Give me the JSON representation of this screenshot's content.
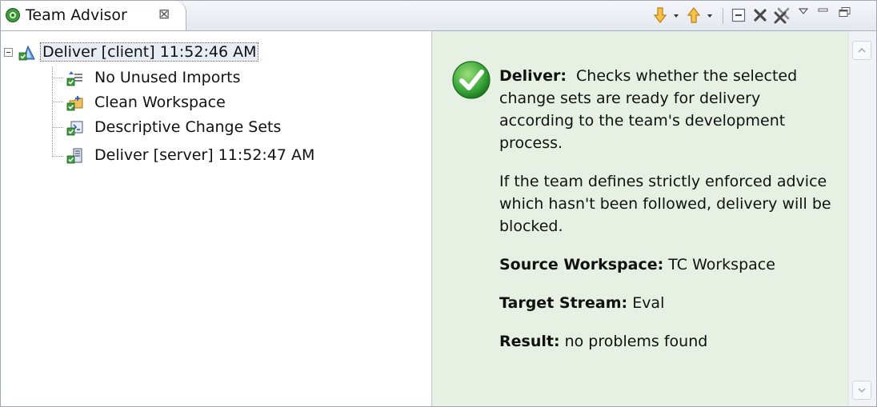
{
  "tab": {
    "title": "Team Advisor",
    "close_glyph": "⊠",
    "icon": "team-advisor-icon"
  },
  "toolbar": {
    "icons": [
      "next-arrow-icon",
      "dropdown-icon",
      "previous-arrow-icon",
      "dropdown-icon",
      "collapse-all-icon",
      "remove-icon",
      "remove-all-icon",
      "view-menu-icon",
      "minimize-icon",
      "maximize-icon"
    ]
  },
  "tree": {
    "root": {
      "label": "Deliver [client] 11:52:46 AM",
      "icon": "deliver-advisor-icon",
      "expanded": true,
      "selected": true
    },
    "children": [
      {
        "label": "No Unused Imports",
        "icon": "imports-check-icon"
      },
      {
        "label": "Clean Workspace",
        "icon": "workspace-check-icon"
      },
      {
        "label": "Descriptive Change Sets",
        "icon": "change-set-check-icon"
      },
      {
        "label": "Deliver [server] 11:52:47 AM",
        "icon": "server-check-icon"
      }
    ]
  },
  "detail": {
    "status_icon": "success-check-icon",
    "status_color": "#3aa63a",
    "heading": "Deliver:",
    "description": "Checks whether the selected change sets are ready for delivery according to the team's development process.",
    "note": "If the team defines strictly enforced advice which hasn't been followed, delivery will be blocked.",
    "source_label": "Source Workspace:",
    "source_value": "TC Workspace",
    "target_label": "Target Stream:",
    "target_value": "Eval",
    "result_label": "Result:",
    "result_value": "no problems found"
  },
  "colors": {
    "detail_background": "#e6f1e3",
    "arrow_orange": "#f0a020",
    "remove_gray": "#555555"
  }
}
